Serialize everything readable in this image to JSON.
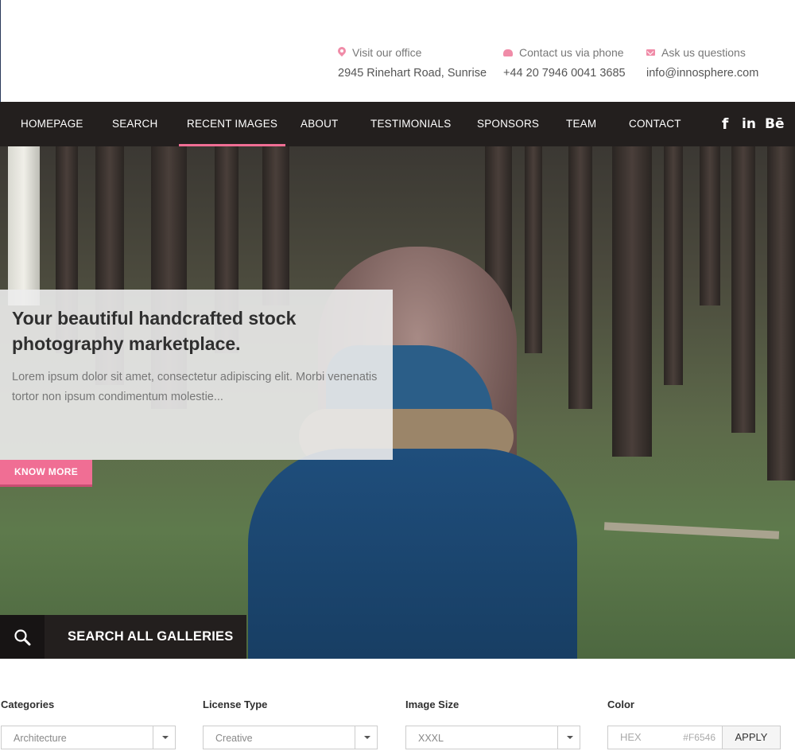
{
  "contact": {
    "office": {
      "label": "Visit our office",
      "value": "2945 Rinehart Road, Sunrise"
    },
    "phone": {
      "label": "Contact us via phone",
      "value": "+44 20 7946 0041 3685"
    },
    "email": {
      "label": "Ask us questions",
      "value": "info@innosphere.com"
    }
  },
  "nav": {
    "items": [
      "HOMEPAGE",
      "SEARCH",
      "RECENT IMAGES",
      "ABOUT",
      "TESTIMONIALS",
      "SPONSORS",
      "TEAM",
      "CONTACT"
    ],
    "active": "RECENT IMAGES",
    "social": {
      "facebook": "f",
      "linkedin": "in",
      "behance": "Bē"
    }
  },
  "hero": {
    "title": "Your beautiful handcrafted stock photography marketplace.",
    "text": "Lorem ipsum dolor sit amet, consectetur adipiscing elit. Morbi venenatis tortor non ipsum condimentum molestie...",
    "button": "KNOW MORE",
    "search_label": "SEARCH ALL GALLERIES"
  },
  "filters": {
    "categories": {
      "label": "Categories",
      "value": "Architecture"
    },
    "license": {
      "label": "License Type",
      "value": "Creative"
    },
    "size": {
      "label": "Image Size",
      "value": "XXXL"
    },
    "color": {
      "label": "Color",
      "placeholder": "HEX",
      "value": "#F6546",
      "button": "APPLY"
    }
  },
  "colors": {
    "accent": "#f06e94",
    "nav_bg": "#231f1e"
  }
}
